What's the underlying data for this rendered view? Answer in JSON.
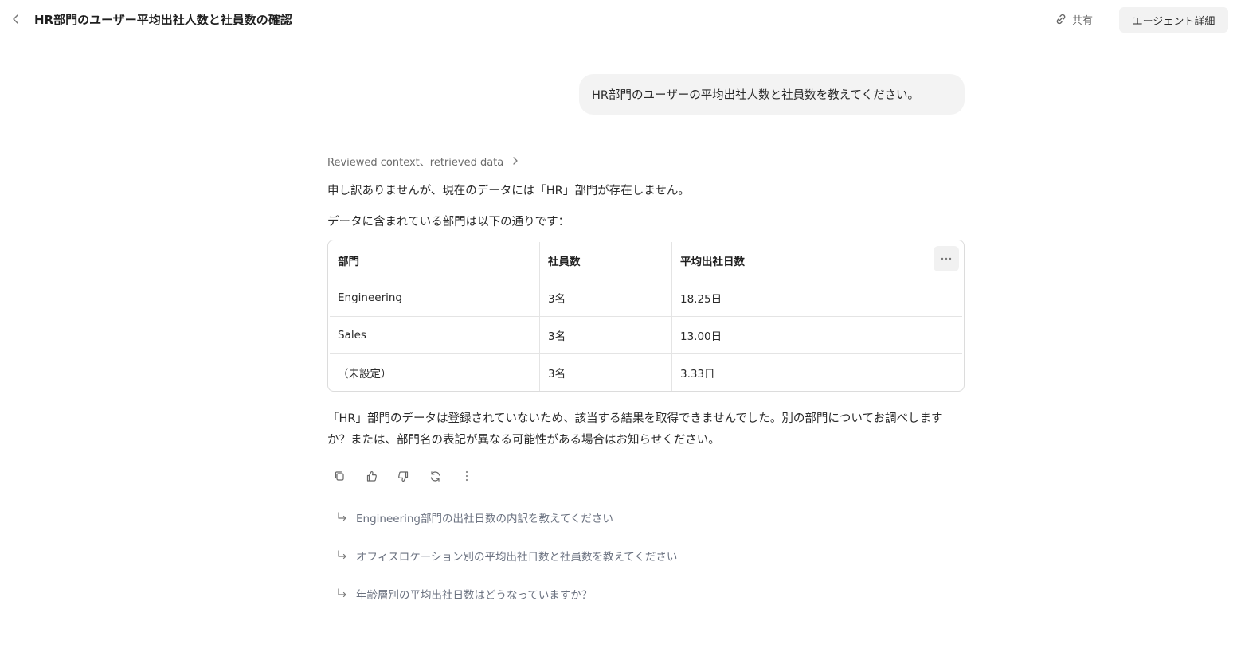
{
  "header": {
    "title": "HR部門のユーザー平均出社人数と社員数の確認",
    "share_label": "共有",
    "agent_details_label": "エージェント詳細"
  },
  "user_message": "HR部門のユーザーの平均出社人数と社員数を教えてください。",
  "assistant": {
    "reviewed_label": "Reviewed context、retrieved data",
    "para1": "申し訳ありませんが、現在のデータには「HR」部門が存在しません。",
    "para2": "データに含まれている部門は以下の通りです：",
    "table": {
      "headers": [
        "部門",
        "社員数",
        "平均出社日数"
      ],
      "rows": [
        [
          "Engineering",
          "3名",
          "18.25日"
        ],
        [
          "Sales",
          "3名",
          "13.00日"
        ],
        [
          "（未設定）",
          "3名",
          "3.33日"
        ]
      ]
    },
    "para3": "「HR」部門のデータは登録されていないため、該当する結果を取得できませんでした。別の部門についてお調べしますか？または、部門名の表記が異なる可能性がある場合はお知らせください。"
  },
  "suggestions": [
    "Engineering部門の出社日数の内訳を教えてください",
    "オフィスロケーション別の平均出社日数と社員数を教えてください",
    "年齢層別の平均出社日数はどうなっていますか？"
  ],
  "icons": {
    "back": "chevron-left-icon",
    "share": "link-icon",
    "reviewed": "chevron-right-icon",
    "table_more": "more-horizontal-icon",
    "actions": [
      "copy-icon",
      "thumbs-up-icon",
      "thumbs-down-icon",
      "refresh-icon",
      "more-vertical-icon"
    ],
    "suggestion": "arrow-return-icon"
  }
}
